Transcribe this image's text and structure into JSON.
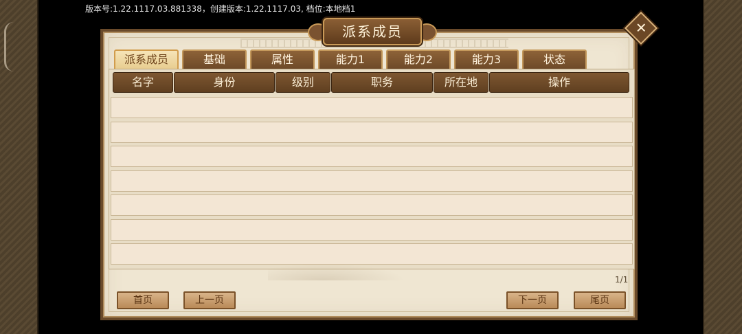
{
  "version_text": "版本号:1.22.1117.03.881338，创建版本:1.22.1117.03, 档位:本地档1",
  "window": {
    "title": "派系成员",
    "close_icon": "close-x-icon"
  },
  "tabs": [
    {
      "label": "派系成员",
      "active": true
    },
    {
      "label": "基础",
      "active": false
    },
    {
      "label": "属性",
      "active": false
    },
    {
      "label": "能力1",
      "active": false
    },
    {
      "label": "能力2",
      "active": false
    },
    {
      "label": "能力3",
      "active": false
    },
    {
      "label": "状态",
      "active": false
    }
  ],
  "table": {
    "columns": [
      "名字",
      "身份",
      "级别",
      "职务",
      "所在地",
      "操作"
    ],
    "rows": [
      [],
      [],
      [],
      [],
      [],
      [],
      []
    ]
  },
  "pagination": {
    "page_indicator": "1/1",
    "first_label": "首页",
    "prev_label": "上一页",
    "next_label": "下一页",
    "last_label": "尾页"
  },
  "colors": {
    "panel_bg": "#efe6d2",
    "frame_brown": "#6a4a2a",
    "header_brown": "#7e5731",
    "active_tab": "#f6e4b8",
    "row_bg": "#f3e6d4"
  }
}
